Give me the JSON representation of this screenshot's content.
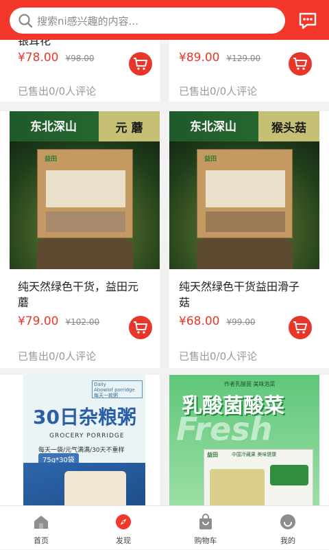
{
  "header": {
    "search_placeholder": "搜索ni感兴趣的内容...",
    "icons": [
      "search-icon",
      "chat-icon"
    ],
    "accent": "#f2372a"
  },
  "products": [
    {
      "title": "银耳花",
      "price": "¥78.00",
      "old_price": "¥98.00",
      "sold": "已售出0/0人评论"
    },
    {
      "title": "",
      "price": "¥89.00",
      "old_price": "¥129.00",
      "sold": "已售出0/0人评论"
    },
    {
      "title": "纯天然绿色干货，益田元蘑",
      "price": "¥79.00",
      "old_price": "¥102.00",
      "sold": "已售出0/0人评论",
      "banner_left": "东北深山",
      "banner_right": "元 蘑",
      "brand": "益田"
    },
    {
      "title": "纯天然绿色干货益田滑子菇",
      "price": "¥68.00",
      "old_price": "¥99.00",
      "sold": "已售出0/0人评论",
      "banner_left": "东北深山",
      "banner_right": "猴头菇",
      "brand": "益田"
    },
    {
      "img_title": "30日杂粮粥",
      "img_sub": "GROCERY PORRIDGE",
      "img_desc": "每天一袋/元气满满/30天不重样",
      "img_badge": "75g*30袋",
      "img_tag1": "Daily",
      "img_tag2": "Abowlof porridge",
      "img_tag3": "每天一款粥"
    },
    {
      "img_title": "乳酸菌酸菜",
      "img_bg_text": "Fresh",
      "img_top": "中国冷藏果 美味健康",
      "brand": "益田"
    }
  ],
  "tabs": [
    {
      "label": "首页",
      "icon": "home-icon"
    },
    {
      "label": "发现",
      "icon": "compass-icon",
      "active": true
    },
    {
      "label": "购物车",
      "icon": "shopping-bag-icon"
    },
    {
      "label": "我的",
      "icon": "profile-face-icon"
    }
  ]
}
